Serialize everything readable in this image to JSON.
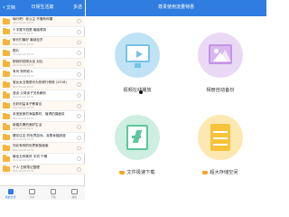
{
  "left": {
    "back_label": "文档",
    "title": "日常生活篇",
    "select_label": "多选",
    "files": [
      {
        "name": "嗨行吧！老公主·不懂有科模",
        "date": "2017-04-10 10:57"
      },
      {
        "name": "十字路节拍是 最值得哭",
        "date": "2017-04-10 10:57"
      },
      {
        "name": "家长们最好 最纳百岁",
        "date": "2017-04-10 10:57"
      },
      {
        "name": "图片",
        "date": "2017-04-10 10:57"
      },
      {
        "name": "刚到的拍照大全 对比",
        "date": "2017-04-10 10:57"
      },
      {
        "name": "有何 别吧老人",
        "date": "2017-04-10 10:57"
      },
      {
        "name": "宝女女当爸爸可为的修行修炼 (2018)",
        "date": "2017-04-10 10:57"
      },
      {
        "name": "漫谈·父母亲子关系解析",
        "date": "2017-04-10 10:57"
      },
      {
        "name": "无彩利益亲子教育合",
        "date": "2017-04-10 10:57"
      },
      {
        "name": "亲宝宝家的海量素材，值得拍摄细讲",
        "date": "2017-04-10 10:57"
      },
      {
        "name": "新婚夫妻的美好生活",
        "date": "2017-04-10 10:57"
      },
      {
        "name": "樱花往友 的世界游戏，真是幸福浪漫",
        "date": "2017-04-10 10:57"
      },
      {
        "name": "河北有种的世界家族面面",
        "date": "2017-04-10 10:57"
      },
      {
        "name": "最佳五种美好 手机 千穗",
        "date": "2017-04-10 10:57"
      },
      {
        "name": "个人 日常笔记整理",
        "date": "2017-04-10 10:57"
      }
    ],
    "tabs": [
      {
        "label": "我的文件",
        "icon": "folder-icon"
      },
      {
        "label": "分享",
        "icon": "share-icon"
      },
      {
        "label": "下载",
        "icon": "download-icon"
      },
      {
        "label": "我的",
        "icon": "user-icon"
      }
    ]
  },
  "right": {
    "title": "尊贵使用流量特惠",
    "features": [
      {
        "label": "视频在线播放",
        "icon": "video-play-icon"
      },
      {
        "label": "相册自动备份",
        "icon": "photo-icon"
      },
      {
        "label": "文件极速下载",
        "icon": "fast-download-icon"
      },
      {
        "label": "超大存储空间",
        "icon": "storage-icon"
      }
    ],
    "download_mark": "≋"
  },
  "colors": {
    "header_blue": "#2f7de1",
    "folder_yellow": "#f5b53a",
    "video_blue": "#76c2e6",
    "photo_purple": "#c394e4",
    "download_green": "#5cc79c",
    "storage_gold": "#f7c33b"
  }
}
